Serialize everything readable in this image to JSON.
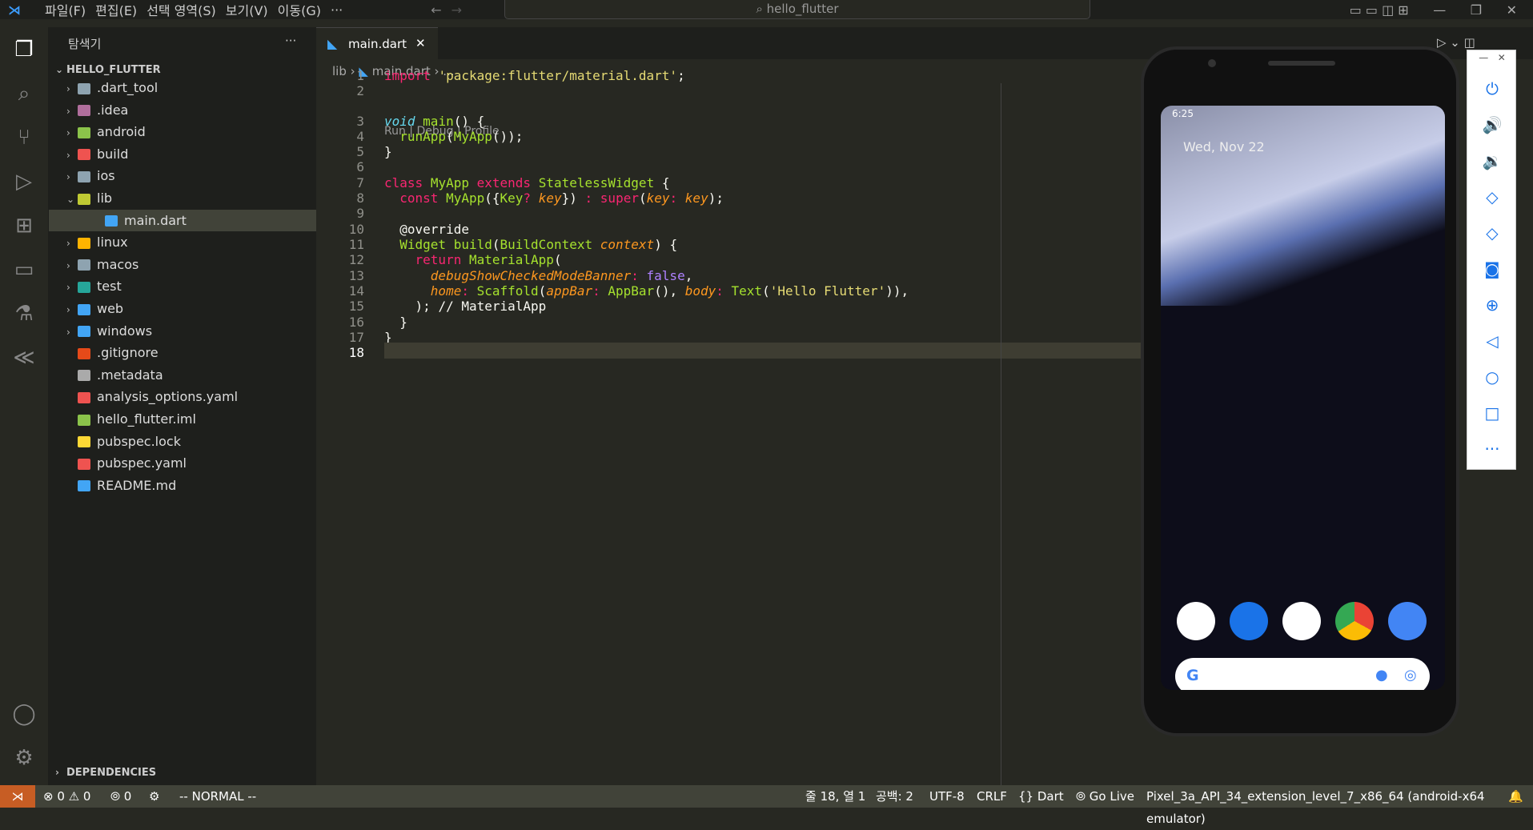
{
  "menu": [
    "파일(F)",
    "편집(E)",
    "선택 영역(S)",
    "보기(V)",
    "이동(G)",
    "···"
  ],
  "search": "hello_flutter",
  "explorer": {
    "title": "탐색기",
    "more": "···",
    "root": "HELLO_FLUTTER",
    "deps": "DEPENDENCIES",
    "items": [
      {
        "label": ".dart_tool",
        "folder": true,
        "color": "#8ea3b0"
      },
      {
        "label": ".idea",
        "folder": true,
        "color": "#b06e9c"
      },
      {
        "label": "android",
        "folder": true,
        "color": "#8bc34a"
      },
      {
        "label": "build",
        "folder": true,
        "color": "#ef5350"
      },
      {
        "label": "ios",
        "folder": true,
        "color": "#8ea3b0"
      },
      {
        "label": "lib",
        "folder": true,
        "open": true,
        "color": "#c0ca33"
      },
      {
        "label": "main.dart",
        "folder": false,
        "child": true,
        "selected": true,
        "color": "#42a5f5"
      },
      {
        "label": "linux",
        "folder": true,
        "color": "#ffb300"
      },
      {
        "label": "macos",
        "folder": true,
        "color": "#8ea3b0"
      },
      {
        "label": "test",
        "folder": true,
        "color": "#26a69a"
      },
      {
        "label": "web",
        "folder": true,
        "color": "#42a5f5"
      },
      {
        "label": "windows",
        "folder": true,
        "color": "#42a5f5"
      },
      {
        "label": ".gitignore",
        "folder": false,
        "color": "#e64a19"
      },
      {
        "label": ".metadata",
        "folder": false,
        "color": "#aaaaaa"
      },
      {
        "label": "analysis_options.yaml",
        "folder": false,
        "color": "#ef5350"
      },
      {
        "label": "hello_flutter.iml",
        "folder": false,
        "color": "#8bc34a"
      },
      {
        "label": "pubspec.lock",
        "folder": false,
        "color": "#fdd835"
      },
      {
        "label": "pubspec.yaml",
        "folder": false,
        "color": "#ef5350"
      },
      {
        "label": "README.md",
        "folder": false,
        "color": "#42a5f5"
      }
    ]
  },
  "tab": {
    "label": "main.dart",
    "close": "✕"
  },
  "breadcrumb": {
    "a": "lib",
    "b": "main.dart",
    "c": "..."
  },
  "codelens": "Run | Debug | Profile",
  "lines": [
    "1",
    "2",
    "3",
    "4",
    "5",
    "6",
    "7",
    "8",
    "9",
    "10",
    "11",
    "12",
    "13",
    "14",
    "15",
    "16",
    "17",
    "18"
  ],
  "comment": "// MaterialApp",
  "status": {
    "errors": "⊗ 0 ⚠ 0",
    "ports": "0",
    "mode": "-- NORMAL --",
    "pos": "줄 18, 열 1",
    "spaces": "공백: 2",
    "enc": "UTF-8",
    "eol": "CRLF",
    "lang": "{} Dart",
    "live": "Go Live",
    "device": "Pixel_3a_API_34_extension_level_7_x86_64 (android-x64 emulator)"
  },
  "phone": {
    "time": "6:25",
    "date": "Wed, Nov 22"
  }
}
